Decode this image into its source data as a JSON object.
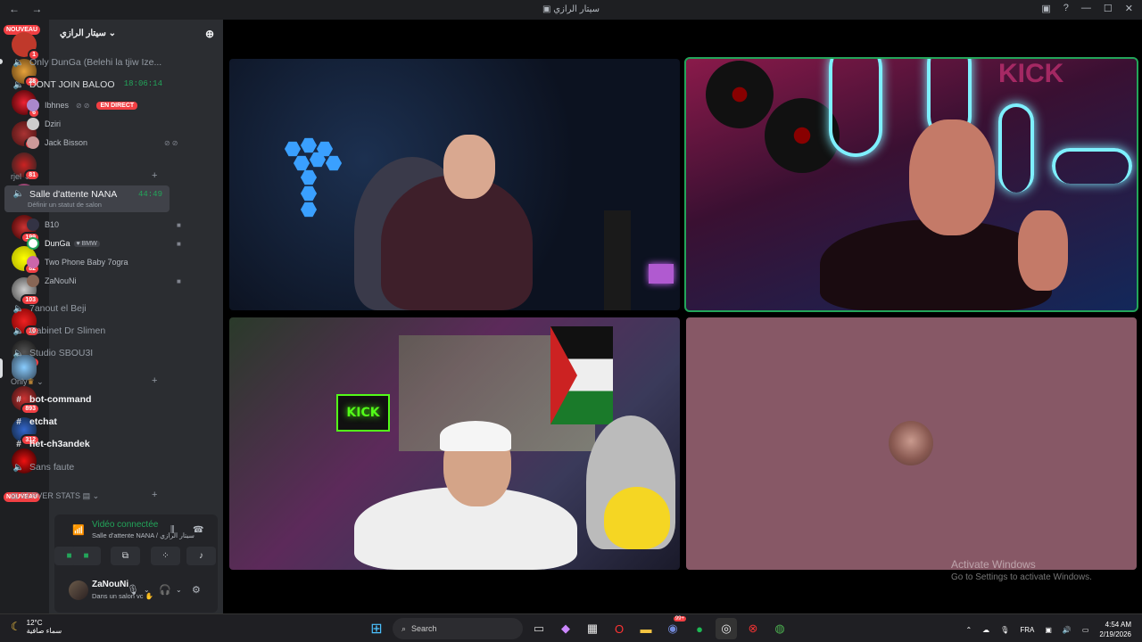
{
  "window": {
    "title": "سيتار الرازي",
    "back": "←",
    "forward": "→"
  },
  "servers": {
    "nouveau_top": "NOUVEAU",
    "nouveau_bottom": "NOUVEAU",
    "badges": [
      "1",
      "28",
      "6",
      "22",
      "81",
      "80",
      "199",
      "82",
      "103",
      "10",
      "3",
      "893",
      "312"
    ]
  },
  "sidebar": {
    "server_name": "سيتار الرازي",
    "channels": {
      "c1": "Only DunGa (Belehi la tjiw Ize...",
      "c2": "DONT JOIN BALOO",
      "c2_time": "18:06:14",
      "cat_rjel": "rjel",
      "c3": "Salle d'attente NANA",
      "c3_time": "44:49",
      "c3_status": "Définir un statut de salon",
      "c4": "7anout el Beji",
      "c5": "Cabinet Dr Slimen",
      "c6": "Studio SBOU3I",
      "cat_only": "Only",
      "c7": "bot-command",
      "c8": "etchat",
      "c9": "het-ch3andek",
      "c10": "Sans faute",
      "cat_stats": "SERVER STATS"
    },
    "users_c2": [
      "Ibhnes",
      "Dziri",
      "Jack Bisson"
    ],
    "live_label": "EN DIRECT",
    "users_c3": [
      "B10",
      "DunGa",
      "Two Phone Baby 7ogra",
      "ZaNouNi"
    ],
    "dunga_tag": "BMW"
  },
  "voice_panel": {
    "status": "Vidéo connectée",
    "channel": "Salle d'attente NANA / سيتار الرازي",
    "username": "ZaNouNi",
    "user_status": "Dans un salon vc"
  },
  "stage": {
    "watermark_title": "Activate Windows",
    "watermark_sub": "Go to Settings to activate Windows."
  },
  "stream_overlay": {
    "kick_top": "KICK",
    "kick_bottom": "KICK"
  },
  "taskbar": {
    "weather_temp": "12°C",
    "weather_desc": "سماء صافية",
    "search_label": "Search",
    "discord_badge": "99+",
    "lang": "FRA",
    "time": "4:54 AM",
    "date": "2/19/2026"
  }
}
